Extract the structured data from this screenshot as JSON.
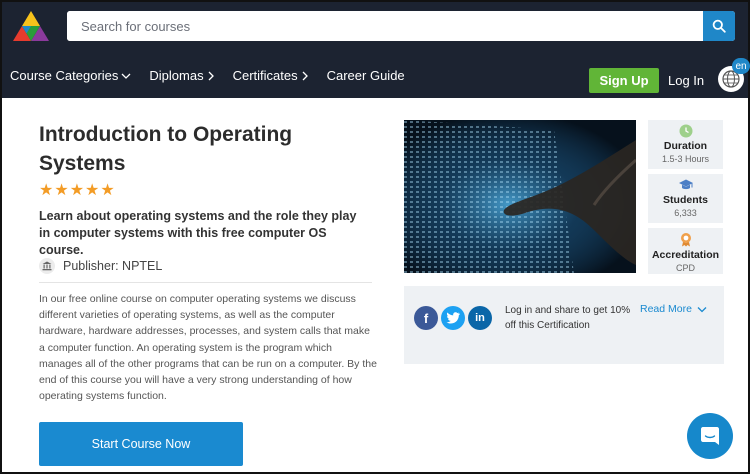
{
  "header": {
    "search_placeholder": "Search for courses",
    "nav": [
      "Course Categories",
      "Diplomas",
      "Certificates",
      "Career Guide"
    ],
    "signup_label": "Sign Up",
    "login_label": "Log In",
    "language": "en"
  },
  "course": {
    "title": "Introduction to Operating Systems",
    "rating_stars": "★★★★★",
    "subtitle": "Learn about operating systems and the role they play in computer systems with this free computer OS course.",
    "publisher": "Publisher: NPTEL",
    "description": "In our free online course on computer operating systems we discuss different varieties of operating systems, as well as the computer hardware, hardware addresses, processes, and system calls that make a computer function. An operating system is the program which manages all of the other programs that can be run on a computer. By the end of this course you will have a very strong understanding of how operating systems function.",
    "start_label": "Start Course Now"
  },
  "stats": [
    {
      "label": "Duration",
      "value": "1.5-3 Hours",
      "icon": "clock-icon"
    },
    {
      "label": "Students",
      "value": "6,333",
      "icon": "graduation-cap-icon"
    },
    {
      "label": "Accreditation",
      "value": "CPD",
      "icon": "award-badge-icon"
    }
  ],
  "share": {
    "text": "Log in and share to get 10% off this Certification",
    "read_more": "Read More",
    "networks": [
      "facebook-icon",
      "twitter-icon",
      "linkedin-icon"
    ]
  },
  "colors": {
    "header_bg": "#1c2331",
    "signup_green": "#61b537",
    "primary_blue": "#1a8ad0",
    "star_orange": "#f39c26"
  }
}
